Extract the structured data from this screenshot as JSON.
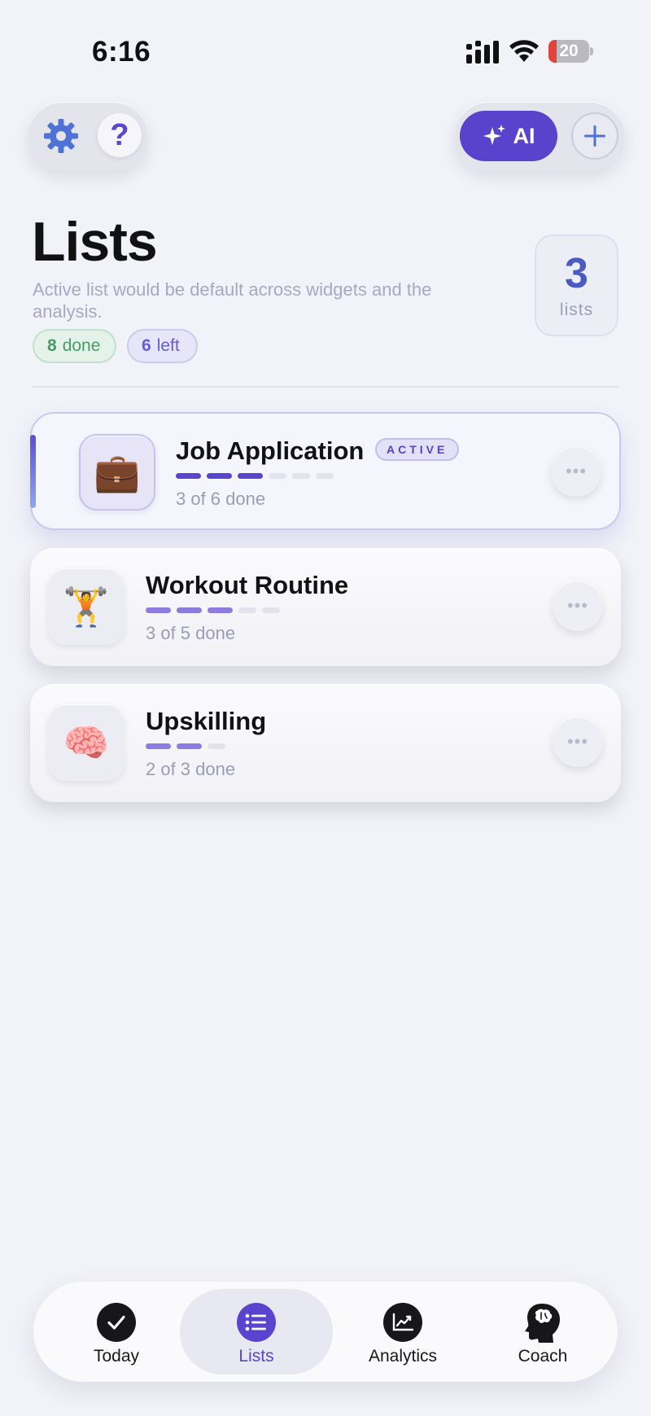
{
  "status_bar": {
    "time": "6:16",
    "battery": "20",
    "battery_level": 0.2
  },
  "toolbar": {
    "ai_label": "AI"
  },
  "header": {
    "title": "Lists",
    "subtitle": "Active list would be default across widgets and the analysis.",
    "done_count": "8",
    "done_label": "done",
    "left_count": "6",
    "left_label": "left",
    "list_count": "3",
    "list_count_label": "lists"
  },
  "lists": [
    {
      "title": "Job Application",
      "emoji": "💼",
      "meta": "3 of 6 done",
      "badge": "ACTIVE",
      "done": 3,
      "total": 6
    },
    {
      "title": "Workout Routine",
      "emoji": "🏋️",
      "meta": "3 of 5 done",
      "done": 3,
      "total": 5
    },
    {
      "title": "Upskilling",
      "emoji": "🧠",
      "meta": "2 of 3 done",
      "done": 2,
      "total": 3
    }
  ],
  "more_glyph": "•••",
  "tabs": [
    {
      "label": "Today"
    },
    {
      "label": "Lists",
      "selected": true
    },
    {
      "label": "Analytics"
    },
    {
      "label": "Coach"
    }
  ],
  "colors": {
    "accent": "#5a44cf",
    "done_green": "#4a9a6b",
    "battery_red": "#e5413b"
  }
}
